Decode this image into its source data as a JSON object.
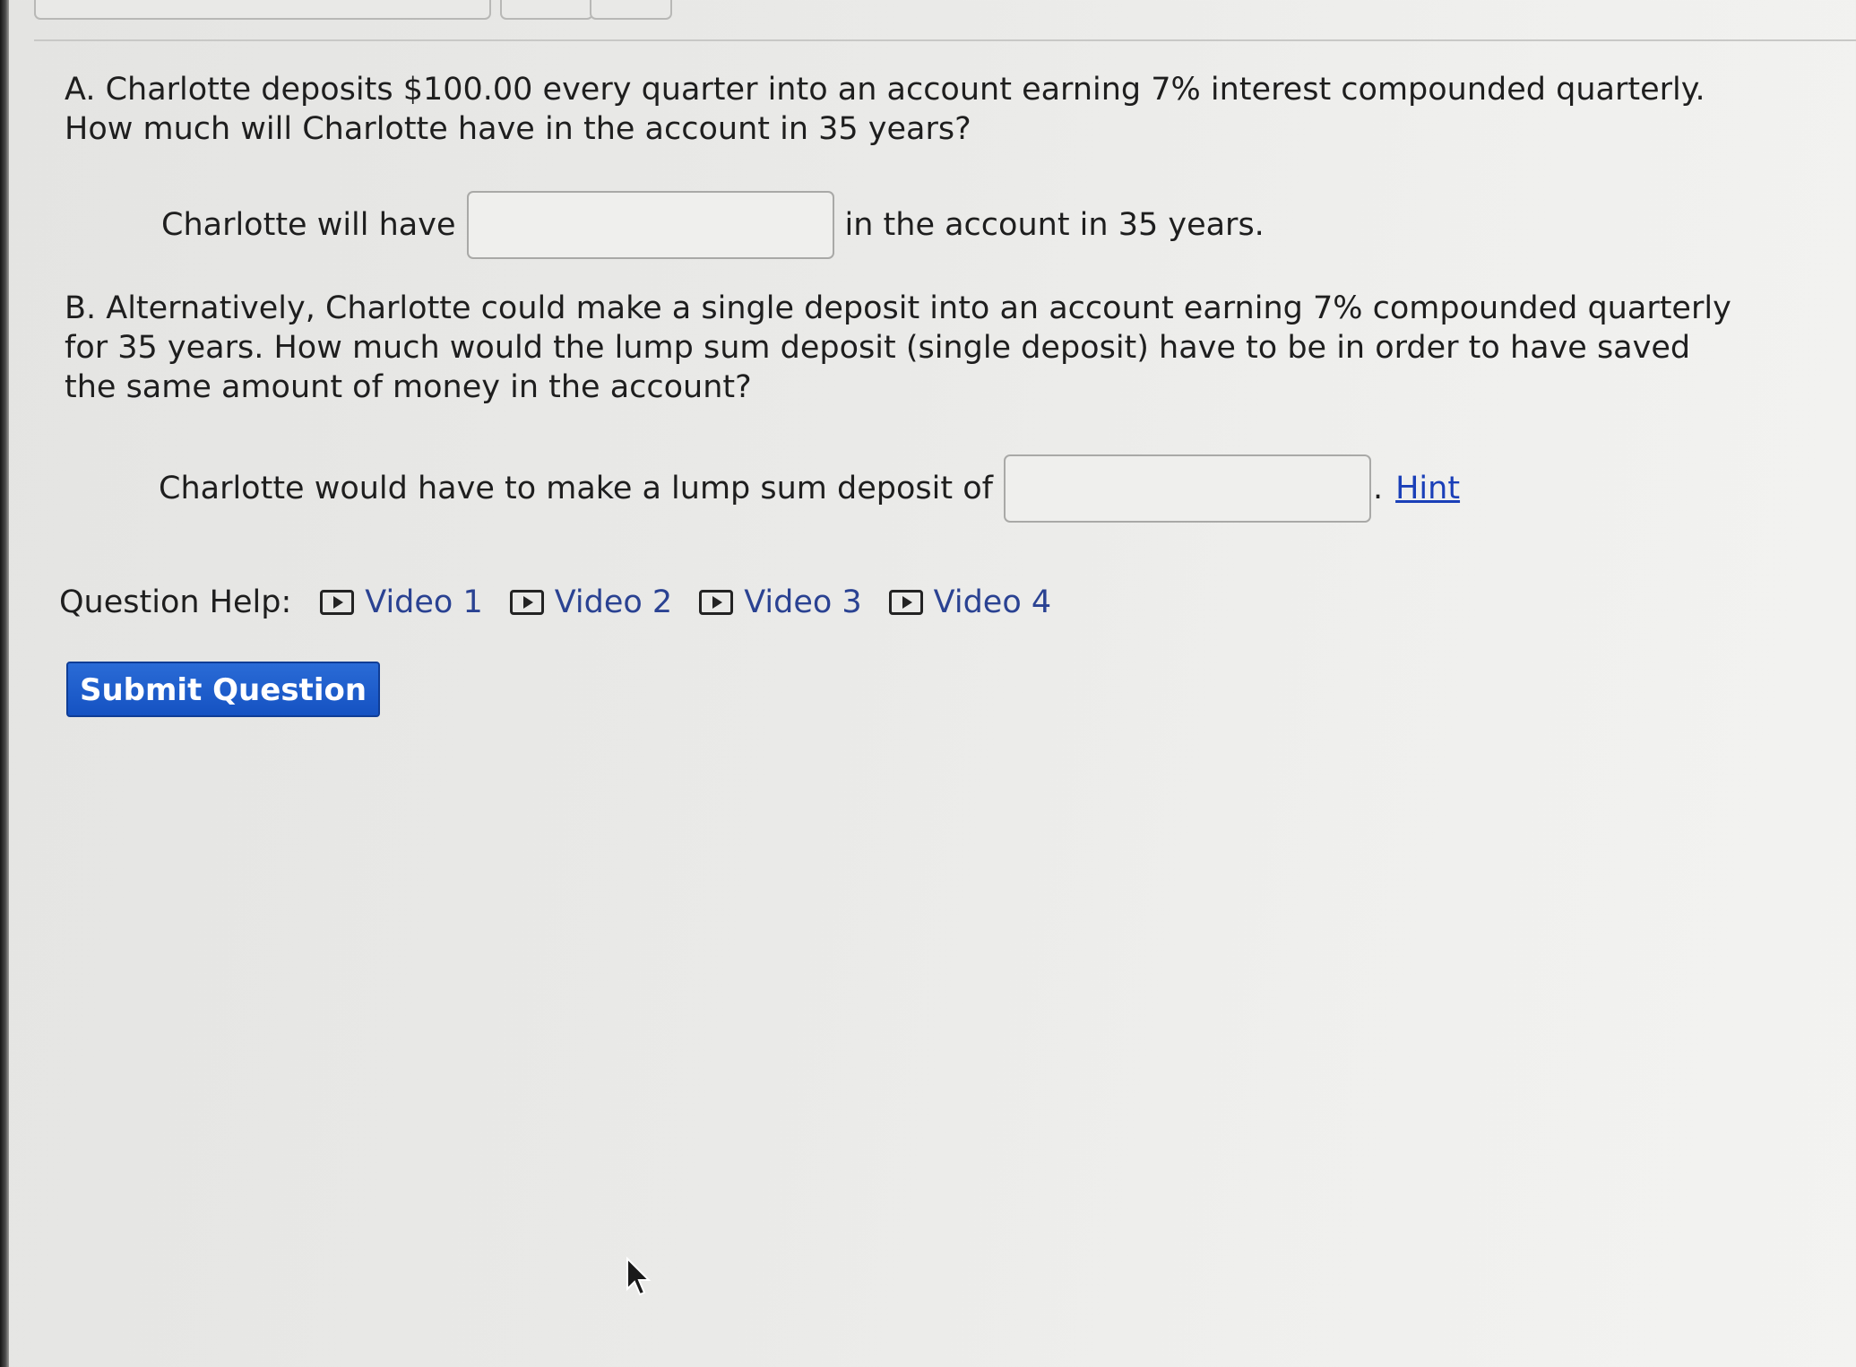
{
  "part_a": {
    "question": "A. Charlotte deposits $100.00 every quarter into an account earning 7% interest compounded quarterly. How much will Charlotte have in the account in 35 years?",
    "answer_prefix": "Charlotte will have",
    "answer_suffix": "in the account in 35 years.",
    "answer_value": ""
  },
  "part_b": {
    "question": "B. Alternatively, Charlotte could make a single deposit into an account earning 7% compounded quarterly for 35 years. How much would the lump sum deposit (single deposit) have to be in order to have saved the same amount of money in the account?",
    "answer_prefix": "Charlotte would have to make a lump sum deposit of",
    "answer_suffix": ".",
    "answer_value": "",
    "hint_label": "Hint"
  },
  "question_help": {
    "label": "Question Help:",
    "videos": [
      {
        "label": "Video 1",
        "icon": "play-icon"
      },
      {
        "label": "Video 2",
        "icon": "play-icon"
      },
      {
        "label": "Video 3",
        "icon": "play-icon"
      },
      {
        "label": "Video 4",
        "icon": "play-icon"
      }
    ]
  },
  "submit_label": "Submit Question",
  "colors": {
    "link": "#1a3fb8",
    "submit_bg": "#1d5fcf",
    "background": "#ebebe9"
  }
}
